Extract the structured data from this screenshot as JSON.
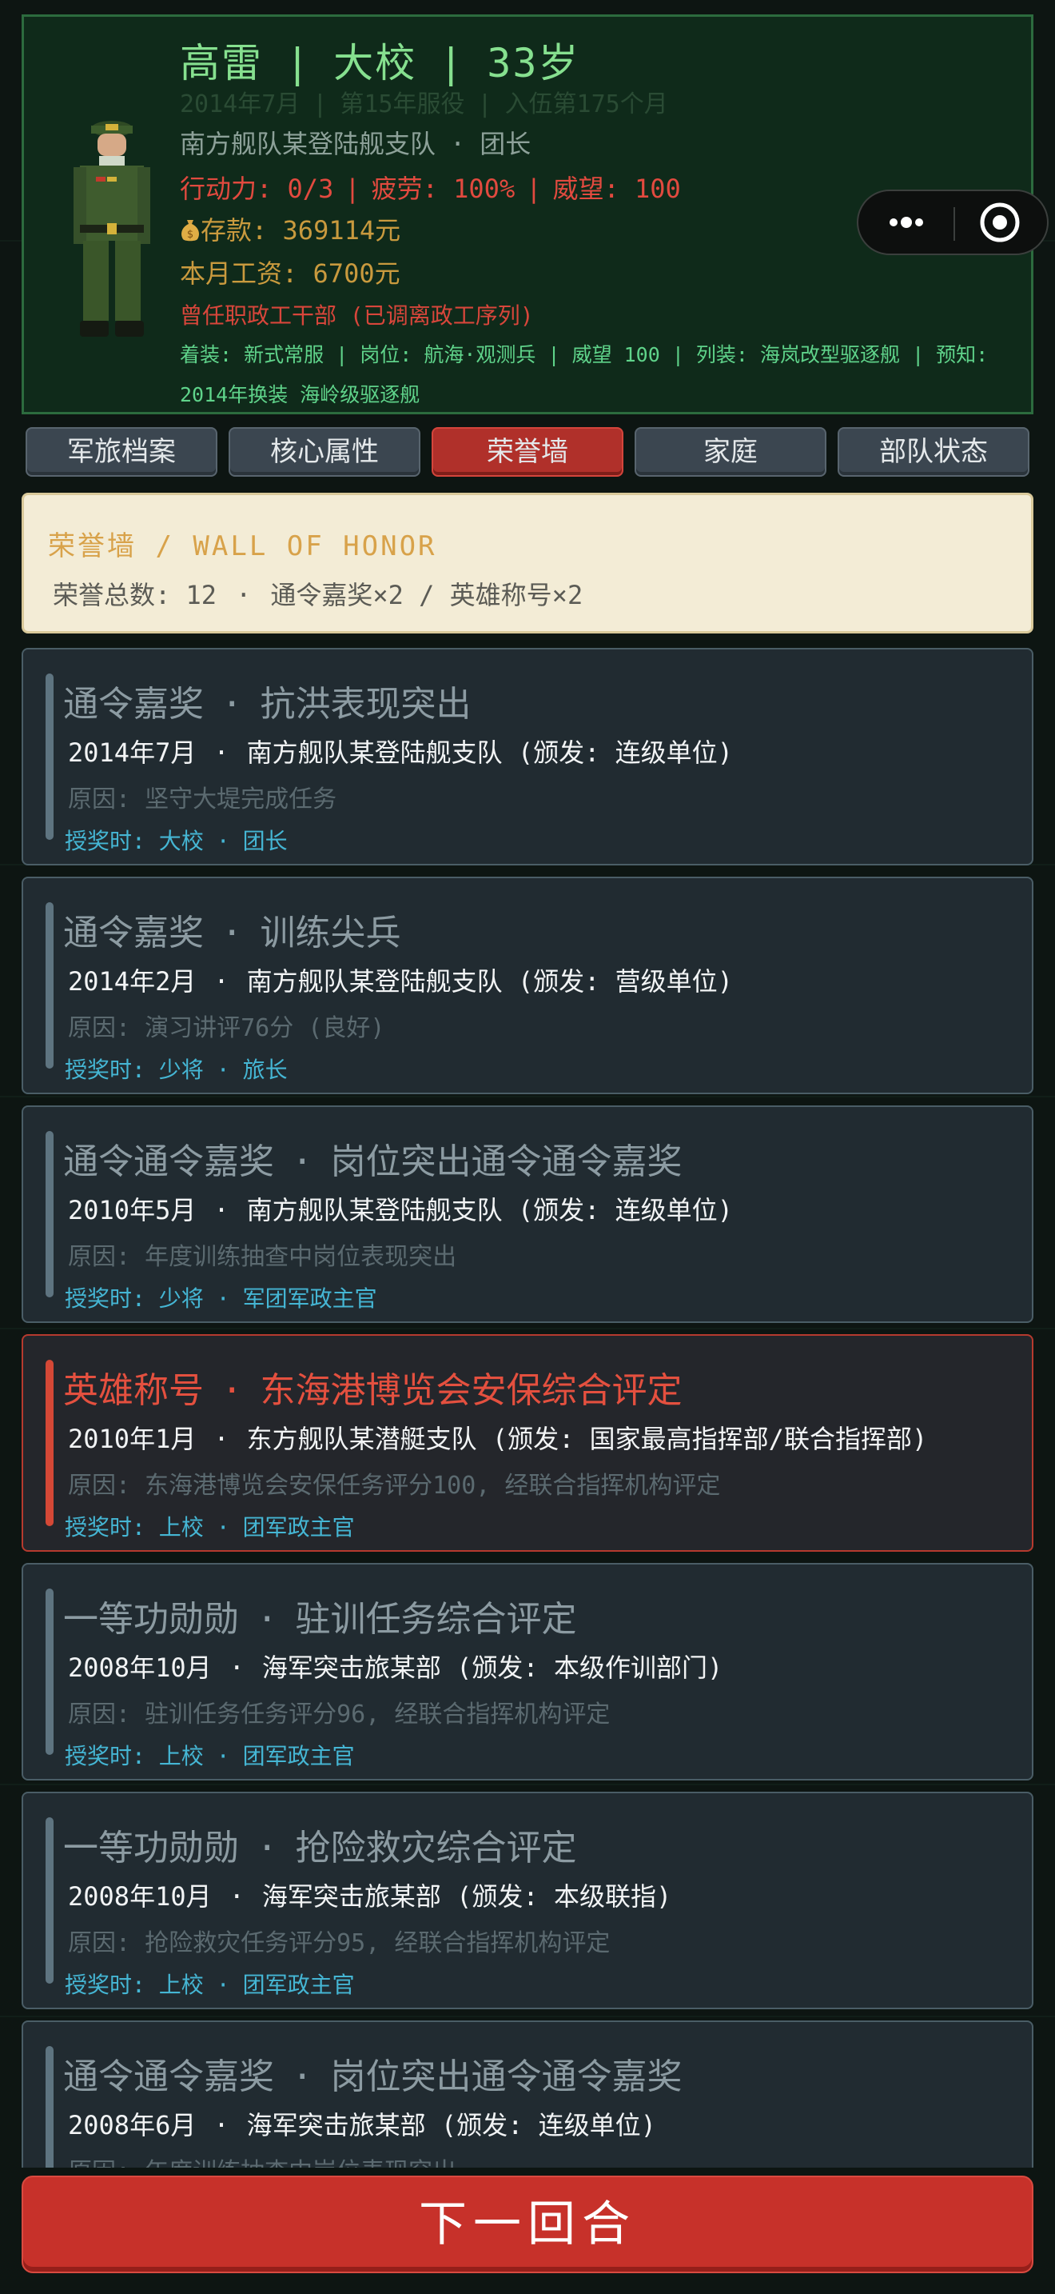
{
  "profile": {
    "name": "高雷",
    "rank": "大校",
    "age": "33岁",
    "service_date": "2014年7月",
    "service_years": "第15年服役",
    "enlist_months": "入伍第175个月",
    "unit": "南方舰队某登陆舰支队",
    "position": "团长",
    "action_power": "行动力: 0/3",
    "fatigue": "疲劳: 100%",
    "prestige": "威望: 100",
    "savings_icon": "money-bag-icon",
    "savings": "存款: 369114元",
    "salary": "本月工资: 6700元",
    "former_post": "曾任职政工干部 (已调离政工序列)",
    "detail": "着装: 新式常服 | 岗位: 航海·观测兵 | 威望 100 | 列装: 海岚改型驱逐舰 | 预知: 2014年换装 海岭级驱逐舰"
  },
  "capsule": {
    "more_icon": "more-dots-icon",
    "target_icon": "target-circle-icon"
  },
  "tabs": [
    {
      "label": "军旅档案",
      "active": false
    },
    {
      "label": "核心属性",
      "active": false
    },
    {
      "label": "荣誉墙",
      "active": true
    },
    {
      "label": "家庭",
      "active": false
    },
    {
      "label": "部队状态",
      "active": false
    }
  ],
  "honor": {
    "title": "荣誉墙 / WALL OF HONOR",
    "total": "荣誉总数: 12",
    "breakdown": "通令嘉奖×2 / 英雄称号×2"
  },
  "awards": [
    {
      "type": "通令嘉奖",
      "name": "抗洪表现突出",
      "date": "2014年7月",
      "unit_issuer": "南方舰队某登陆舰支队 (颁发: 连级单位)",
      "reason": "原因: 坚守大堤完成任务",
      "award_time_label": "授奖时: 大校",
      "award_time_post": "团长",
      "hero": false
    },
    {
      "type": "通令嘉奖",
      "name": "训练尖兵",
      "date": "2014年2月",
      "unit_issuer": "南方舰队某登陆舰支队 (颁发: 营级单位)",
      "reason": "原因: 演习讲评76分 (良好)",
      "award_time_label": "授奖时: 少将",
      "award_time_post": "旅长",
      "hero": false
    },
    {
      "type": "通令通令嘉奖",
      "name": "岗位突出通令通令嘉奖",
      "date": "2010年5月",
      "unit_issuer": "南方舰队某登陆舰支队 (颁发: 连级单位)",
      "reason": "原因: 年度训练抽查中岗位表现突出",
      "award_time_label": "授奖时: 少将",
      "award_time_post": "军团军政主官",
      "hero": false
    },
    {
      "type": "英雄称号",
      "name": "东海港博览会安保综合评定",
      "date": "2010年1月",
      "unit_issuer": "东方舰队某潜艇支队 (颁发: 国家最高指挥部/联合指挥部)",
      "reason": "原因: 东海港博览会安保任务评分100, 经联合指挥机构评定",
      "award_time_label": "授奖时: 上校",
      "award_time_post": "团军政主官",
      "hero": true
    },
    {
      "type": "一等功勋勋",
      "name": "驻训任务综合评定",
      "date": "2008年10月",
      "unit_issuer": "海军突击旅某部 (颁发: 本级作训部门)",
      "reason": "原因: 驻训任务任务评分96, 经联合指挥机构评定",
      "award_time_label": "授奖时: 上校",
      "award_time_post": "团军政主官",
      "hero": false
    },
    {
      "type": "一等功勋勋",
      "name": "抢险救灾综合评定",
      "date": "2008年10月",
      "unit_issuer": "海军突击旅某部 (颁发: 本级联指)",
      "reason": "原因: 抢险救灾任务评分95, 经联合指挥机构评定",
      "award_time_label": "授奖时: 上校",
      "award_time_post": "团军政主官",
      "hero": false
    },
    {
      "type": "通令通令嘉奖",
      "name": "岗位突出通令通令嘉奖",
      "date": "2008年6月",
      "unit_issuer": "海军突击旅某部 (颁发: 连级单位)",
      "reason": "原因: 年度训练抽查中岗位表现突出",
      "award_time_label": "",
      "award_time_post": "",
      "hero": false
    }
  ],
  "separators": {
    "pipe": "|",
    "dot": "·"
  },
  "next_round": "下一回合",
  "colors": {
    "accent_green": "#86e08f",
    "alert_red": "#e24a3f",
    "gold": "#c99a3e",
    "tab_active": "#b0302a",
    "link_cyan": "#45b6d4"
  }
}
